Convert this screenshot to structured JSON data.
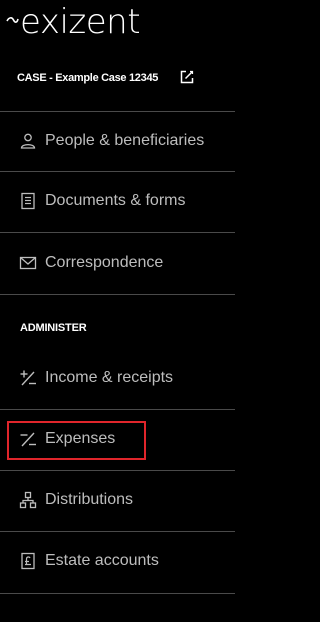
{
  "brand": {
    "logo_text": "exizent"
  },
  "case": {
    "title": "CASE - Example Case 12345",
    "edit_icon": "edit-icon"
  },
  "nav": {
    "items": [
      {
        "label": "People & beneficiaries",
        "icon": "person-icon"
      },
      {
        "label": "Documents & forms",
        "icon": "document-icon"
      },
      {
        "label": "Correspondence",
        "icon": "envelope-icon"
      }
    ]
  },
  "administer": {
    "heading": "ADMINISTER",
    "items": [
      {
        "label": "Income & receipts",
        "icon": "plus-minus-icon"
      },
      {
        "label": "Expenses",
        "icon": "minus-slash-icon",
        "highlighted": true
      },
      {
        "label": "Distributions",
        "icon": "distribution-icon"
      },
      {
        "label": "Estate accounts",
        "icon": "pound-account-icon"
      }
    ]
  },
  "colors": {
    "background": "#000000",
    "text": "#bdbdbd",
    "heading": "#ffffff",
    "divider": "#4a4a4a",
    "highlight": "#e0252b"
  }
}
